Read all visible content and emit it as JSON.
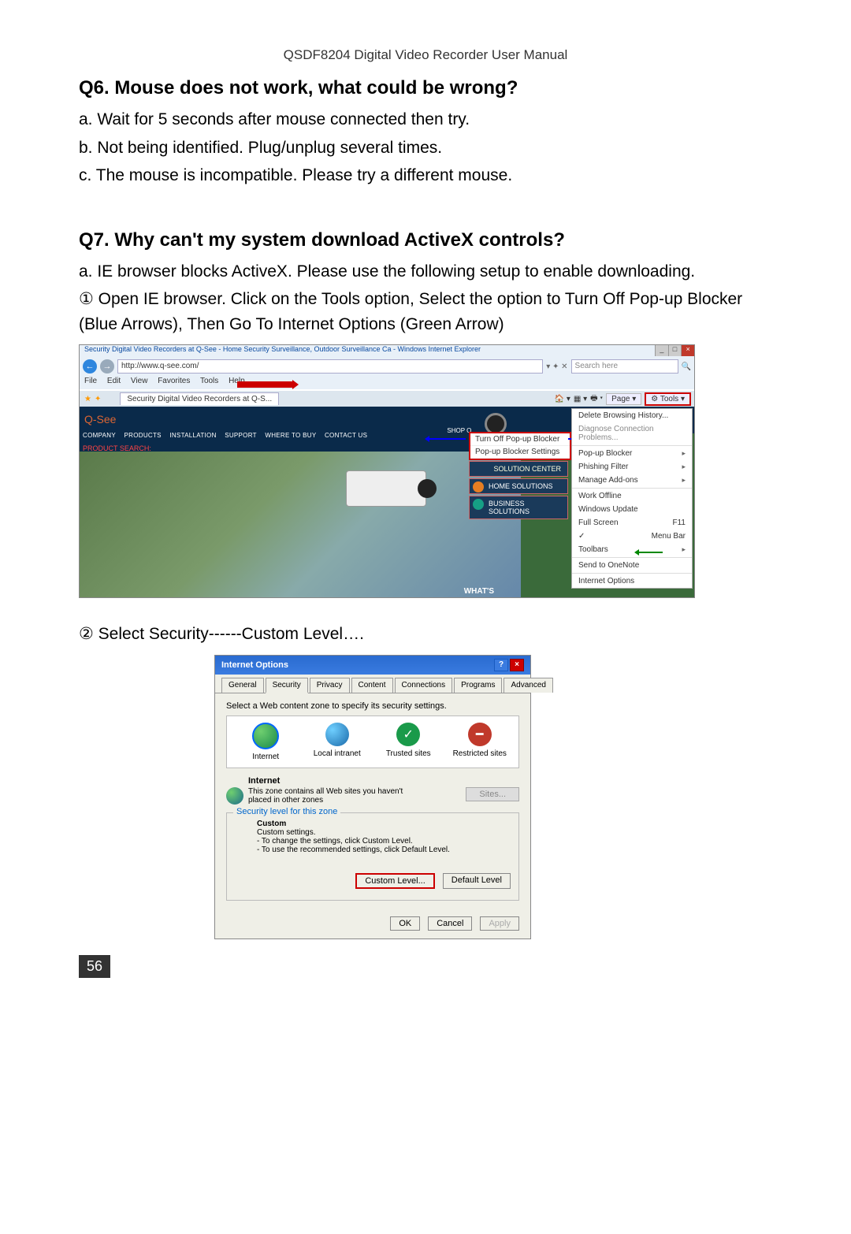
{
  "header": {
    "manual_title": "QSDF8204 Digital Video Recorder User Manual"
  },
  "q6": {
    "heading": "Q6. Mouse does not work, what could be wrong?",
    "a": "a. Wait for 5 seconds after mouse connected then try.",
    "b": "b. Not being identified. Plug/unplug several times.",
    "c": "c. The mouse is incompatible. Please try a different mouse."
  },
  "q7": {
    "heading": "Q7. Why can't my system download ActiveX controls?",
    "intro": "a. IE browser blocks ActiveX. Please use the following setup to enable downloading.",
    "step1": "① Open IE browser. Click on the Tools option, Select the option to Turn Off Pop-up Blocker (Blue Arrows), Then Go To Internet Options (Green Arrow)",
    "step2": "② Select Security------Custom Level…."
  },
  "ie": {
    "title": "Security Digital Video Recorders at Q-See - Home Security Surveillance, Outdoor Surveillance Ca - Windows Internet Explorer",
    "url": "http://www.q-see.com/",
    "search_placeholder": "Search here",
    "menu": {
      "file": "File",
      "edit": "Edit",
      "view": "View",
      "favorites": "Favorites",
      "tools": "Tools",
      "help": "Help"
    },
    "tab": "Security Digital Video Recorders at Q-S...",
    "toolbar": {
      "page": "Page",
      "tools": "Tools"
    },
    "site": {
      "logo": "Q-See",
      "nav": {
        "company": "COMPANY",
        "products": "PRODUCTS",
        "installation": "INSTALLATION",
        "support": "SUPPORT",
        "where": "WHERE TO BUY",
        "contact": "CONTACT US"
      },
      "search_label": "PRODUCT SEARCH:",
      "shop": "SHOP O...",
      "solution_center": "SOLUTION CENTER",
      "home_solutions": "HOME SOLUTIONS",
      "business_solutions": "BUSINESS SOLUTIONS",
      "whats": "WHAT'S"
    },
    "popup_menu": {
      "turn_off": "Turn Off Pop-up Blocker",
      "settings": "Pop-up Blocker Settings"
    },
    "tools_menu": {
      "delete_history": "Delete Browsing History...",
      "diagnose": "Diagnose Connection Problems...",
      "popup": "Pop-up Blocker",
      "phishing": "Phishing Filter",
      "addons": "Manage Add-ons",
      "offline": "Work Offline",
      "update": "Windows Update",
      "fullscreen": "Full Screen",
      "fullscreen_key": "F11",
      "menubar": "Menu Bar",
      "toolbars": "Toolbars",
      "onenote": "Send to OneNote",
      "internet_options": "Internet Options"
    }
  },
  "io": {
    "title": "Internet Options",
    "tabs": {
      "general": "General",
      "security": "Security",
      "privacy": "Privacy",
      "content": "Content",
      "connections": "Connections",
      "programs": "Programs",
      "advanced": "Advanced"
    },
    "zone_desc": "Select a Web content zone to specify its security settings.",
    "zones": {
      "internet": "Internet",
      "intranet": "Local intranet",
      "trusted": "Trusted sites",
      "restricted": "Restricted sites"
    },
    "section": {
      "label": "Internet",
      "desc": "This zone contains all Web sites you haven't placed in other zones",
      "sites": "Sites..."
    },
    "fieldset_legend": "Security level for this zone",
    "custom": {
      "title": "Custom",
      "sub": "Custom settings.",
      "l1": "- To change the settings, click Custom Level.",
      "l2": "- To use the recommended settings, click Default Level."
    },
    "btn_custom": "Custom Level...",
    "btn_default": "Default Level",
    "btn_ok": "OK",
    "btn_cancel": "Cancel",
    "btn_apply": "Apply"
  },
  "page_number": "56"
}
